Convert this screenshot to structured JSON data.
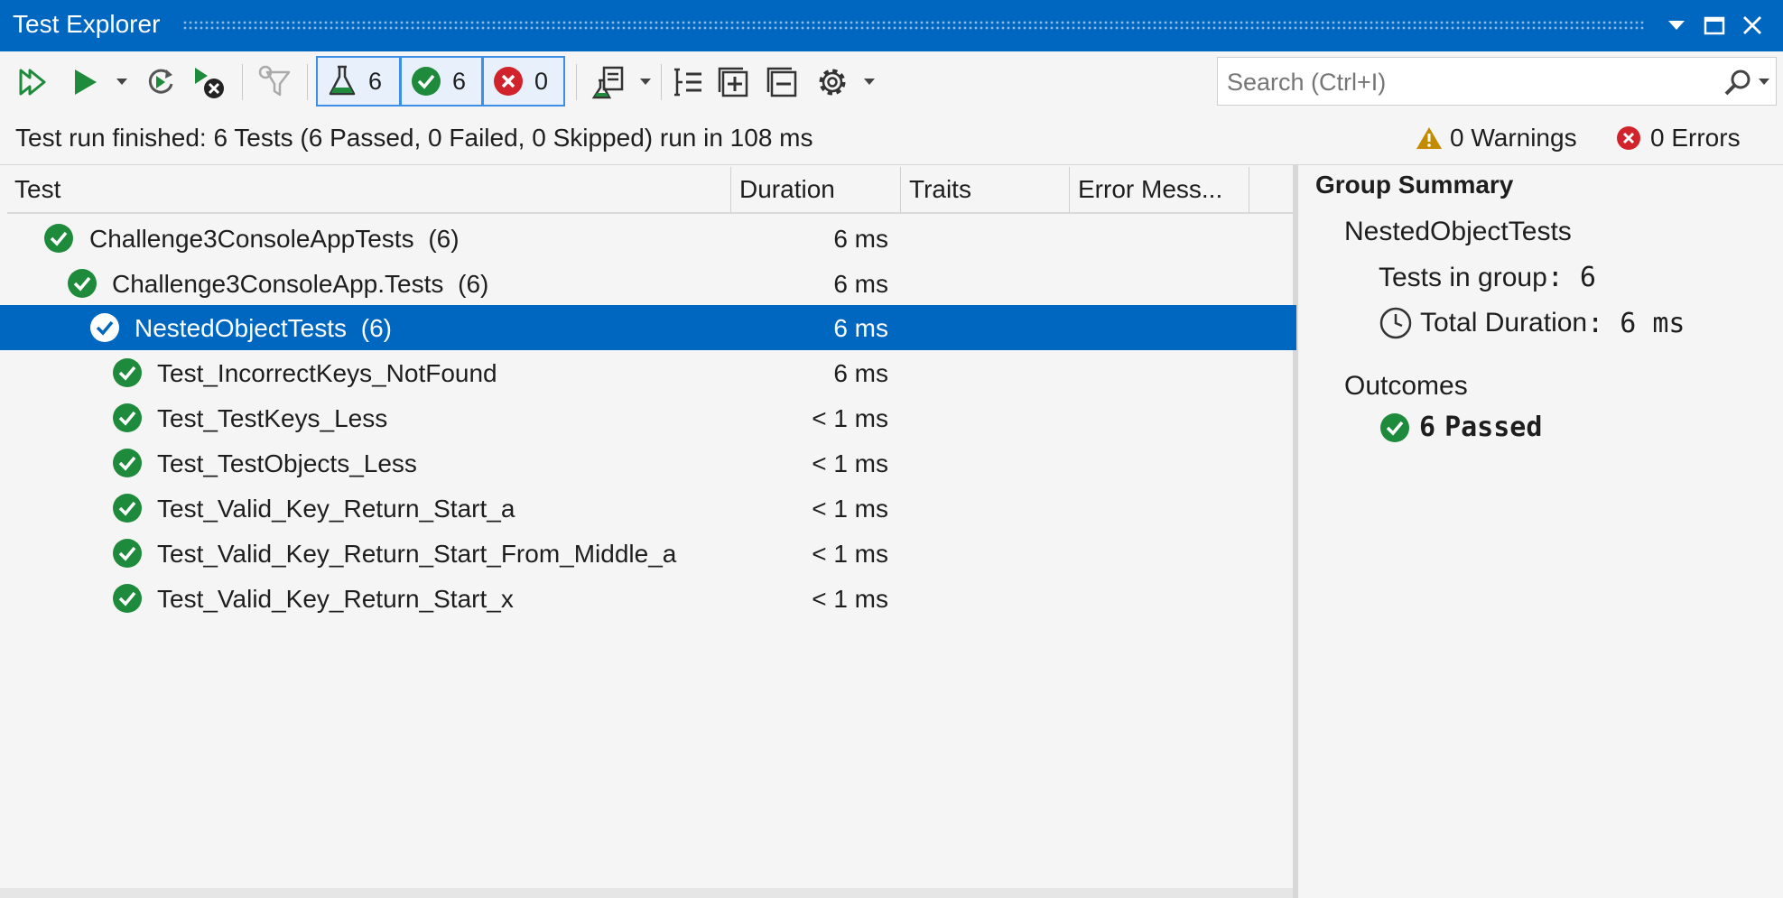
{
  "window": {
    "title": "Test Explorer"
  },
  "toolbar": {
    "filters": {
      "total": "6",
      "passed": "6",
      "failed": "0"
    }
  },
  "search": {
    "placeholder": "Search (Ctrl+I)"
  },
  "status": {
    "message": "Test run finished: 6 Tests (6 Passed, 0 Failed, 0 Skipped) run in 108 ms",
    "warnings": "0 Warnings",
    "errors": "0 Errors"
  },
  "columns": {
    "test": "Test",
    "duration": "Duration",
    "traits": "Traits",
    "error": "Error Mess..."
  },
  "rows": [
    {
      "name": "Challenge3ConsoleAppTests",
      "count": "(6)",
      "duration": "6 ms"
    },
    {
      "name": "Challenge3ConsoleApp.Tests",
      "count": "(6)",
      "duration": "6 ms"
    },
    {
      "name": "NestedObjectTests",
      "count": "(6)",
      "duration": "6 ms"
    },
    {
      "name": "Test_IncorrectKeys_NotFound",
      "duration": "6 ms"
    },
    {
      "name": "Test_TestKeys_Less",
      "duration": "< 1 ms"
    },
    {
      "name": "Test_TestObjects_Less",
      "duration": "< 1 ms"
    },
    {
      "name": "Test_Valid_Key_Return_Start_a",
      "duration": "< 1 ms"
    },
    {
      "name": "Test_Valid_Key_Return_Start_From_Middle_a",
      "duration": "< 1 ms"
    },
    {
      "name": "Test_Valid_Key_Return_Start_x",
      "duration": "< 1 ms"
    }
  ],
  "summary": {
    "heading": "Group Summary",
    "group_name": "NestedObjectTests",
    "tests_in_group_label": "Tests in group",
    "tests_in_group_value": ": 6",
    "total_duration_label": "Total Duration",
    "total_duration_value": ": 6 ms",
    "outcomes_label": "Outcomes",
    "passed_count": "6",
    "passed_label": "Passed"
  },
  "colors": {
    "accent": "#0067c0",
    "pass": "#1e8a3c",
    "fail": "#d1232b",
    "warn": "#c48b00"
  }
}
